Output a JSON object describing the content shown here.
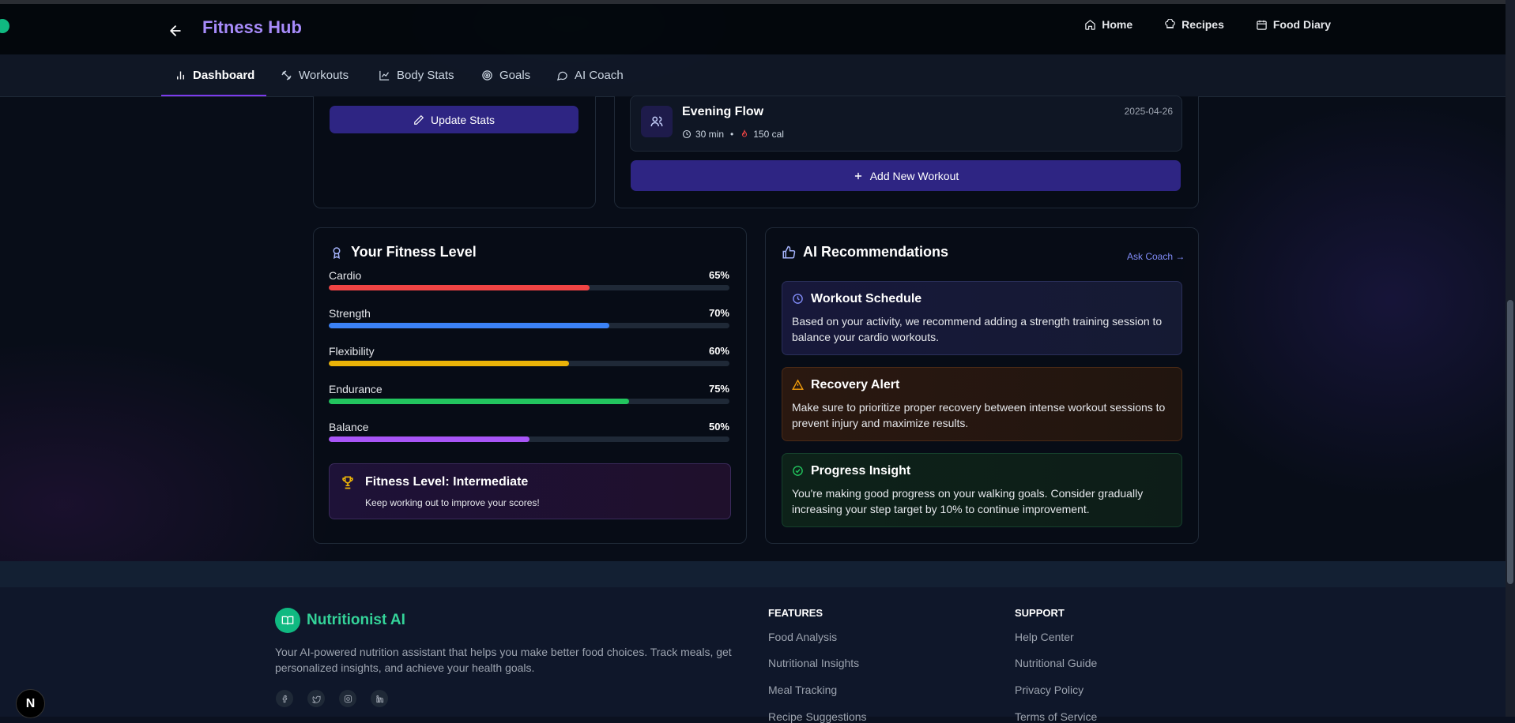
{
  "app": {
    "title": "Fitness Hub"
  },
  "topnav": {
    "home": "Home",
    "recipes": "Recipes",
    "food_diary": "Food Diary"
  },
  "tabs": [
    "Dashboard",
    "Workouts",
    "Body Stats",
    "Goals",
    "AI Coach"
  ],
  "body_stats": {
    "update_label": "Update Stats"
  },
  "workouts": {
    "last": {
      "title": "Evening Flow",
      "duration": "30 min",
      "calories": "150 cal",
      "date": "2025-04-26"
    },
    "add_label": "Add New Workout"
  },
  "fitness": {
    "title": "Your Fitness Level",
    "skills": [
      {
        "label": "Cardio",
        "pct": "65%",
        "value": 0.65,
        "color": "#ef4444"
      },
      {
        "label": "Strength",
        "pct": "70%",
        "value": 0.7,
        "color": "#3b82f6"
      },
      {
        "label": "Flexibility",
        "pct": "60%",
        "value": 0.6,
        "color": "#eab308"
      },
      {
        "label": "Endurance",
        "pct": "75%",
        "value": 0.75,
        "color": "#22c55e"
      },
      {
        "label": "Balance",
        "pct": "50%",
        "value": 0.5,
        "color": "#a855f7"
      }
    ],
    "level_title": "Fitness Level: Intermediate",
    "level_sub": "Keep working out to improve your scores!"
  },
  "ai": {
    "title": "AI Recommendations",
    "ask": "Ask Coach →",
    "cards": [
      {
        "title": "Workout Schedule",
        "body": "Based on your activity, we recommend adding a strength training session to balance your cardio workouts."
      },
      {
        "title": "Recovery Alert",
        "body": "Make sure to prioritize proper recovery between intense workout sessions to prevent injury and maximize results."
      },
      {
        "title": "Progress Insight",
        "body": "You're making good progress on your walking goals. Consider gradually increasing your step target by 10% to continue improvement."
      }
    ]
  },
  "footer": {
    "brand": "Nutritionist AI",
    "desc": "Your AI-powered nutrition assistant that helps you make better food choices. Track meals, get personalized insights, and achieve your health goals.",
    "features_title": "FEATURES",
    "features": [
      "Food Analysis",
      "Nutritional Insights",
      "Meal Tracking",
      "Recipe Suggestions"
    ],
    "support_title": "SUPPORT",
    "support": [
      "Help Center",
      "Nutritional Guide",
      "Privacy Policy",
      "Terms of Service"
    ]
  },
  "badge": "N"
}
